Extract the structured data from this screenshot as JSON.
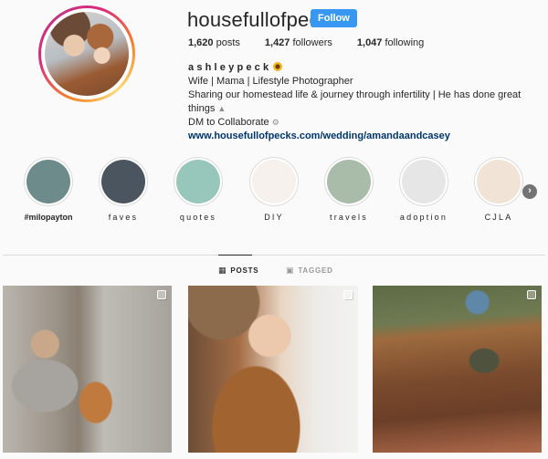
{
  "profile": {
    "username": "housefullofpecks",
    "follow_label": "Follow",
    "stats": [
      {
        "value": "1,620",
        "label": "posts"
      },
      {
        "value": "1,427",
        "label": "followers"
      },
      {
        "value": "1,047",
        "label": "following"
      }
    ],
    "bio": {
      "name": "ashleypeck",
      "name_icon": "sunflower-icon",
      "line1": "Wife | Mama | Lifestyle Photographer",
      "line2": "Sharing our homestead life & journey through infertility | He has done great things",
      "line2_icon": "praying-hands-icon",
      "line3": "DM to Collaborate",
      "line3_icon": "gear-icon",
      "link": "www.housefullofpecks.com/wedding/amandaandcasey"
    }
  },
  "highlights": [
    {
      "label": "#milopayton",
      "color": "#6e8b8c"
    },
    {
      "label": "faves",
      "color": "#4a555f"
    },
    {
      "label": "quotes",
      "color": "#97c6ba"
    },
    {
      "label": "DIY",
      "color": "#f6f1ec"
    },
    {
      "label": "travels",
      "color": "#a8bca9"
    },
    {
      "label": "adoption",
      "color": "#e6e6e6"
    },
    {
      "label": "CJLA",
      "color": "#f1e3d6"
    }
  ],
  "highlights_next_icon": "chevron-right-icon",
  "tabs": [
    {
      "label": "POSTS",
      "icon": "grid-icon",
      "active": true
    },
    {
      "label": "TAGGED",
      "icon": "tagged-icon",
      "active": false
    }
  ],
  "posts": [
    {
      "description": "Toddler in striped onesie looking at chickens through coop wire",
      "icon": "multiple-posts-icon"
    },
    {
      "description": "Mother in hat nuzzling baby in rust-colored wrap carrier",
      "icon": "multiple-posts-icon"
    },
    {
      "description": "Toddler in cap standing beside raised garden bed",
      "icon": "multiple-posts-icon"
    }
  ],
  "colors": {
    "follow_button": "#3897f0",
    "link": "#003569",
    "background": "#fafafa"
  }
}
